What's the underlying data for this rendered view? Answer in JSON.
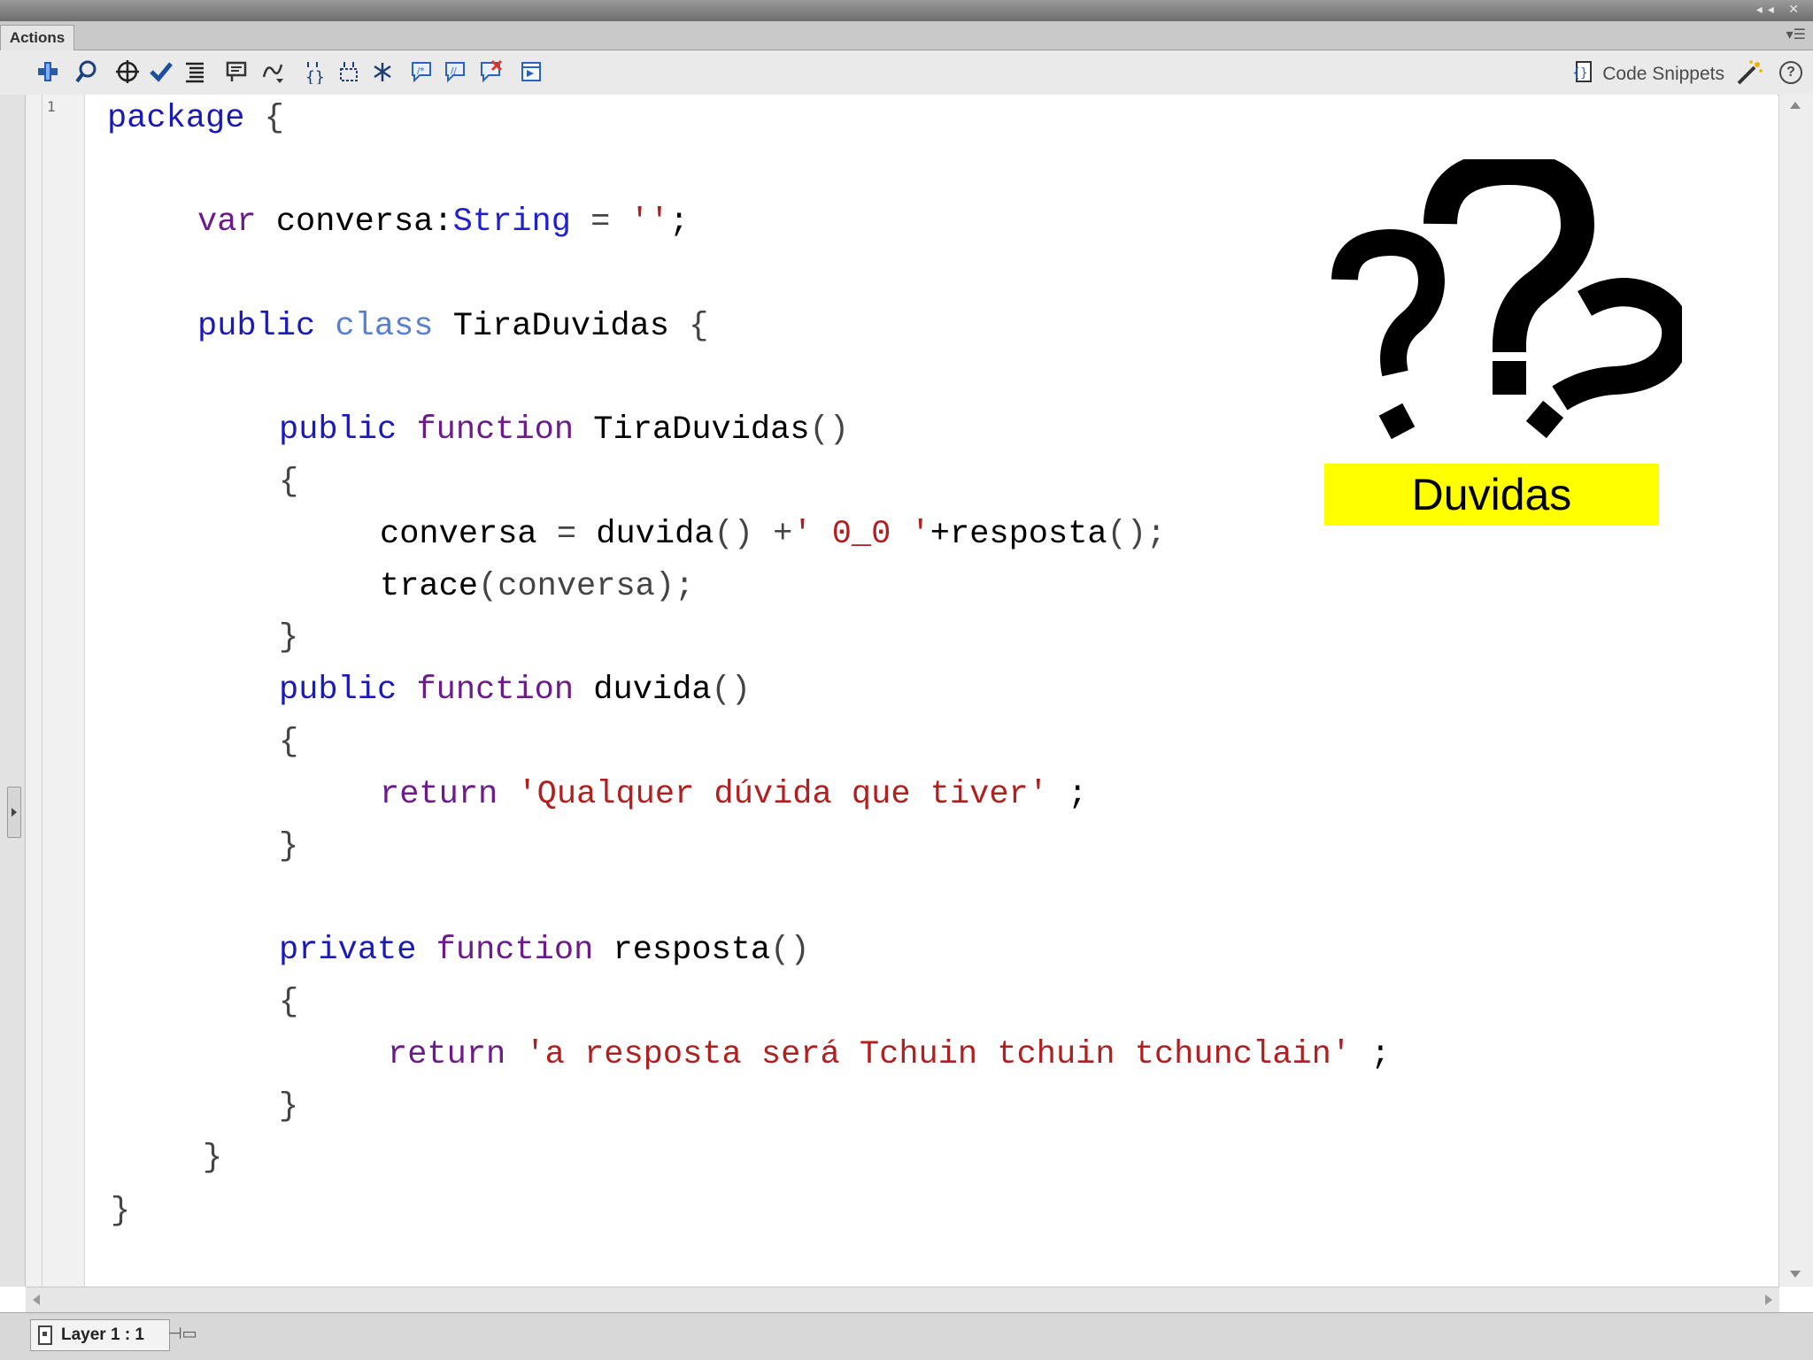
{
  "panel": {
    "tab_label": "Actions",
    "titlebar_buttons": "◂◂ ✕",
    "panel_menu": "▾☰"
  },
  "toolbar": {
    "tools": [
      "add-script-item-icon",
      "find-icon",
      "insert-target-path-icon",
      "check-syntax-icon",
      "auto-format-icon",
      "show-code-hint-icon",
      "debug-options-icon",
      "collapse-between-braces-icon",
      "collapse-selection-icon",
      "expand-all-icon",
      "apply-block-comment-icon",
      "apply-line-comment-icon",
      "remove-comment-icon",
      "show-hide-toolbox-icon"
    ],
    "code_snippets_label": "Code Snippets",
    "help_label": "?"
  },
  "gutter": {
    "line_number": "1"
  },
  "code": {
    "l1": [
      "package",
      " {"
    ],
    "l2": [
      "var",
      " conversa:",
      "String",
      " = ",
      "''",
      ";"
    ],
    "l3": [
      "public",
      " ",
      "class",
      " TiraDuvidas ",
      "{"
    ],
    "l4": [
      "public",
      " ",
      "function",
      " TiraDuvidas",
      "()"
    ],
    "brace_open": "{",
    "brace_close": "}",
    "l6": [
      "conversa ",
      "=",
      " duvida",
      "()",
      " +",
      "' 0_0 '",
      "+resposta",
      "();"
    ],
    "l7": [
      "trace",
      "(conversa);"
    ],
    "l9": [
      "public",
      " ",
      "function",
      " duvida",
      "()"
    ],
    "l11": [
      "return",
      " ",
      "'Qualquer dúvida que tiver'",
      " ;"
    ],
    "l13": [
      "private",
      " ",
      "function",
      " resposta",
      "()"
    ],
    "l15": [
      "return",
      " ",
      "'a resposta será Tchuin tchuin tchunclain'",
      " ;"
    ]
  },
  "overlay": {
    "label": "Duvidas",
    "label_color": "#ffff00",
    "icon": "question-marks-icon"
  },
  "status": {
    "layer_label": "Layer 1 : 1"
  },
  "colors": {
    "keyword": "#1a1ab8",
    "function_keyword": "#6b1c88",
    "string": "#b02020",
    "class_keyword": "#5a7fd0"
  }
}
